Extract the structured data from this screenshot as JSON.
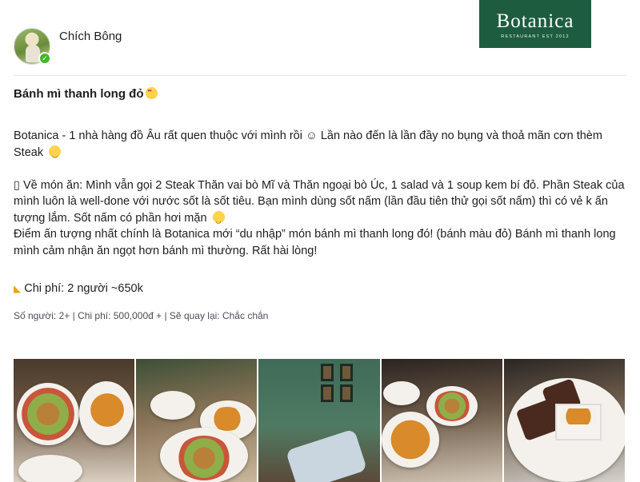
{
  "post": {
    "author": "Chích Bông",
    "title": "Bánh mì thanh long đỏ",
    "paragraphs": [
      "Botanica - 1 nhà hàng đồ Âu rất quen thuộc với mình rồi ☺ Lần nào đến là lần đầy no bụng và thoả mãn cơn thèm Steak",
      "",
      "▯ Về món ăn: Mình vẫn gọi 2 Steak Thăn vai bò Mĩ và Thăn ngoại bò Úc, 1 salad và 1 soup kem bí đỏ. Phần Steak của mình luôn là well-done với nước sốt là sốt tiêu. Bạn mình dùng sốt nấm (lần đầu tiên thử gọi sốt nấm) thì có vẻ k ấn tượng lắm. Sốt nấm có phần hơi mặn",
      "Điểm ấn tượng nhất chính là Botanica mới “du nhập” món bánh mì thanh long đó! (bánh màu đỏ) Bánh mì thanh long mình cảm nhận ăn ngọt hơn bánh mì thường. Rất hài lòng!"
    ],
    "cost": "Chi phí: 2 người ~650k",
    "meta": "Số người: 2+ | Chi phí: 500,000đ + | Sẽ quay lại: Chắc chắn"
  },
  "logo": {
    "brand": "Botanica",
    "tagline": "RESTAURANT EST 2012"
  },
  "icons": {
    "title_emoji": "heart-eyes-emoji-icon",
    "laugh_emoji": "laughing-emoji-icon",
    "cost_icon": "pizza-icon",
    "verified": "verified-check-icon"
  },
  "colors": {
    "logo_bg": "#1e5c3f",
    "verified": "#42b72a"
  }
}
